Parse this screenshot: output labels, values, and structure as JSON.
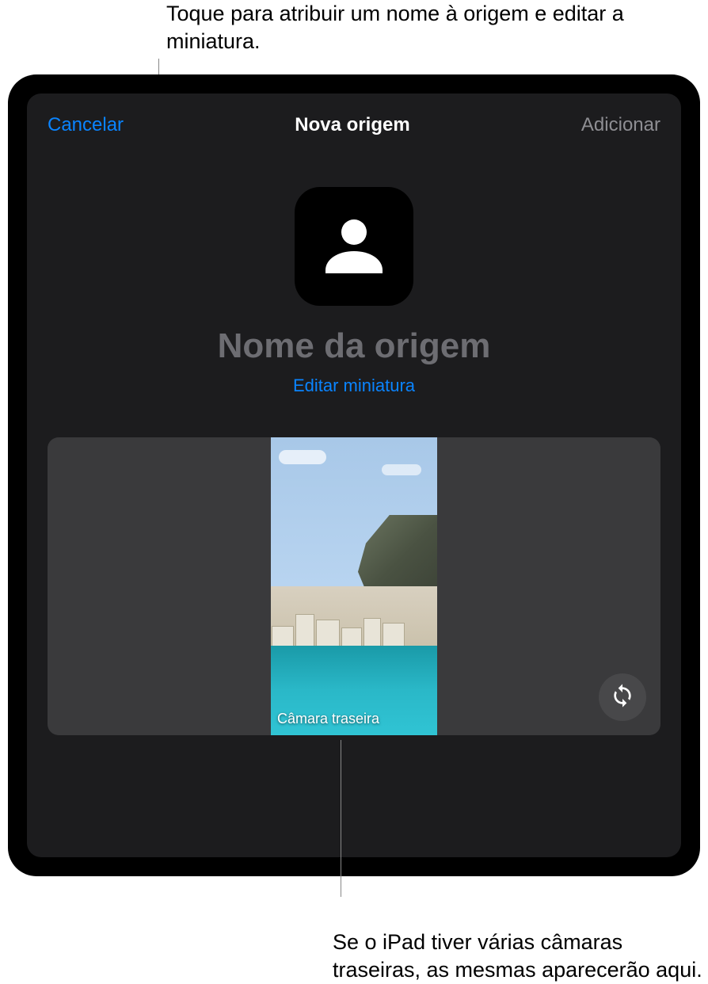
{
  "annotations": {
    "top": "Toque para atribuir um nome à origem e editar a miniatura.",
    "bottom": "Se o iPad tiver várias câmaras traseiras, as mesmas aparecerão aqui."
  },
  "nav": {
    "cancel": "Cancelar",
    "title": "Nova origem",
    "add": "Adicionar"
  },
  "source": {
    "name_placeholder": "Nome da origem",
    "edit_thumbnail": "Editar miniatura"
  },
  "preview": {
    "camera_label": "Câmara traseira"
  }
}
